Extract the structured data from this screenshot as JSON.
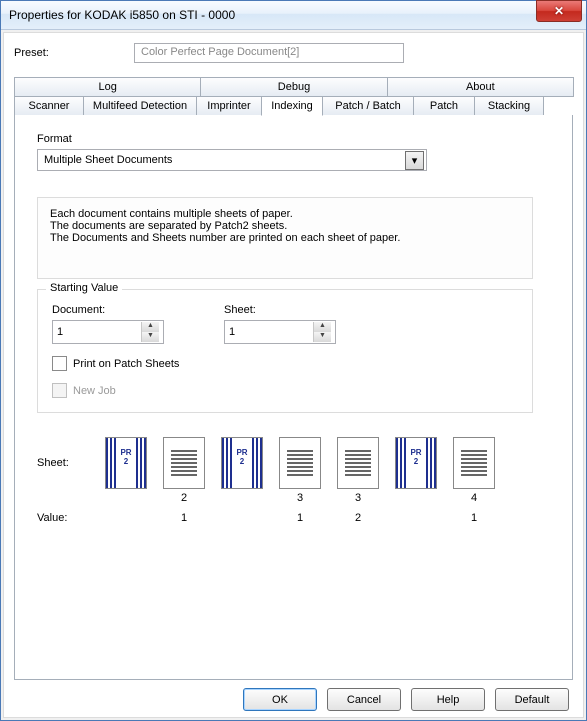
{
  "window": {
    "title": "Properties for KODAK i5850 on STI - 0000"
  },
  "preset": {
    "label": "Preset:",
    "value": "Color Perfect Page Document[2]"
  },
  "tabsTop": {
    "log": "Log",
    "debug": "Debug",
    "about": "About"
  },
  "tabs": {
    "scanner": "Scanner",
    "multifeed": "Multifeed Detection",
    "imprinter": "Imprinter",
    "indexing": "Indexing",
    "patchbatch": "Patch / Batch",
    "patch": "Patch",
    "stacking": "Stacking"
  },
  "format": {
    "label": "Format",
    "value": "Multiple Sheet Documents"
  },
  "description": {
    "l1": "Each document contains multiple sheets of paper.",
    "l2": "The documents are separated by Patch2  sheets.",
    "l3": "The Documents and Sheets number are printed on each sheet of paper."
  },
  "starting": {
    "legend": "Starting Value",
    "documentLabel": "Document:",
    "documentValue": "1",
    "sheetLabel": "Sheet:",
    "sheetValue": "1",
    "printOnPatch": "Print on Patch Sheets",
    "newJob": "New Job"
  },
  "preview": {
    "sheetLabel": "Sheet:",
    "valueLabel": "Value:",
    "pr2": "PR\n2",
    "items": [
      {
        "kind": "patch",
        "under": ""
      },
      {
        "kind": "doc",
        "under": "2"
      },
      {
        "kind": "patch",
        "under": ""
      },
      {
        "kind": "doc",
        "under": "3"
      },
      {
        "kind": "doc",
        "under": "3"
      },
      {
        "kind": "patch",
        "under": ""
      },
      {
        "kind": "doc",
        "under": "4"
      }
    ],
    "values": [
      "",
      "1",
      "",
      "1",
      "2",
      "",
      "1"
    ]
  },
  "buttons": {
    "ok": "OK",
    "cancel": "Cancel",
    "help": "Help",
    "default": "Default"
  }
}
